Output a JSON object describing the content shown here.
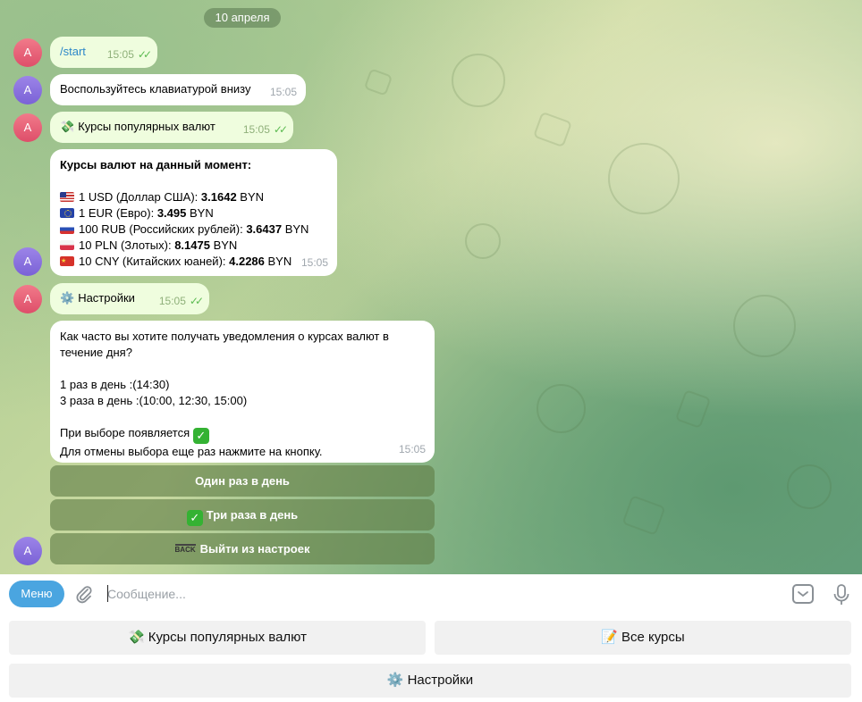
{
  "date_divider": "10 апреля",
  "avatar_letter": "A",
  "messages": {
    "start": {
      "text": "/start",
      "time": "15:05",
      "checks": "✓✓"
    },
    "hint": {
      "text": "Воспользуйтесь клавиатурой внизу",
      "time": "15:05"
    },
    "rates_cmd": {
      "emoji": "💸",
      "text": "Курсы популярных валют",
      "time": "15:05",
      "checks": "✓✓"
    },
    "rates": {
      "title": "Курсы валют на данный момент:",
      "rows": [
        {
          "flag": "us",
          "label": "1 USD (Доллар США): ",
          "value": "3.1642",
          "unit": " BYN"
        },
        {
          "flag": "eu",
          "label": "1 EUR (Евро): ",
          "value": "3.495",
          "unit": " BYN"
        },
        {
          "flag": "ru",
          "label": "100 RUB (Российских рублей): ",
          "value": "3.6437",
          "unit": " BYN"
        },
        {
          "flag": "pl",
          "label": "10 PLN (Злотых): ",
          "value": "8.1475",
          "unit": " BYN"
        },
        {
          "flag": "cn",
          "label": "10 CNY (Китайских юаней): ",
          "value": "4.2286",
          "unit": " BYN"
        }
      ],
      "time": "15:05"
    },
    "settings_cmd": {
      "emoji": "⚙️",
      "text": "Настройки",
      "time": "15:05",
      "checks": "✓✓"
    },
    "settings": {
      "line1": "Как часто вы хотите получать уведомления о курсах валют в",
      "line2": "течение дня?",
      "line3": "1 раз в день :(14:30)",
      "line4": "3 раза в день :(10:00, 12:30, 15:00)",
      "line5": "При выборе появляется",
      "line5_mark": "✓",
      "line6": "Для отмены выбора еще раз нажмите на кнопку.",
      "time": "15:05"
    }
  },
  "inline_buttons": {
    "once": "Один раз в день",
    "thrice_mark": "✓",
    "thrice": "Три раза в день",
    "back_icon": "BACK",
    "exit": "Выйти из настроек"
  },
  "composer": {
    "menu_label": "Меню",
    "placeholder": "Сообщение..."
  },
  "reply_keyboard": {
    "popular": {
      "emoji": "💸",
      "label": "Курсы популярных валют"
    },
    "all": {
      "emoji": "📝",
      "label": "Все курсы"
    },
    "settings": {
      "emoji": "⚙️",
      "label": "Настройки"
    }
  },
  "colors": {
    "outgoing_bubble": "#effdde",
    "incoming_bubble": "#ffffff",
    "menu_button": "#4aa5e0",
    "check_marks": "#5dbb52"
  }
}
